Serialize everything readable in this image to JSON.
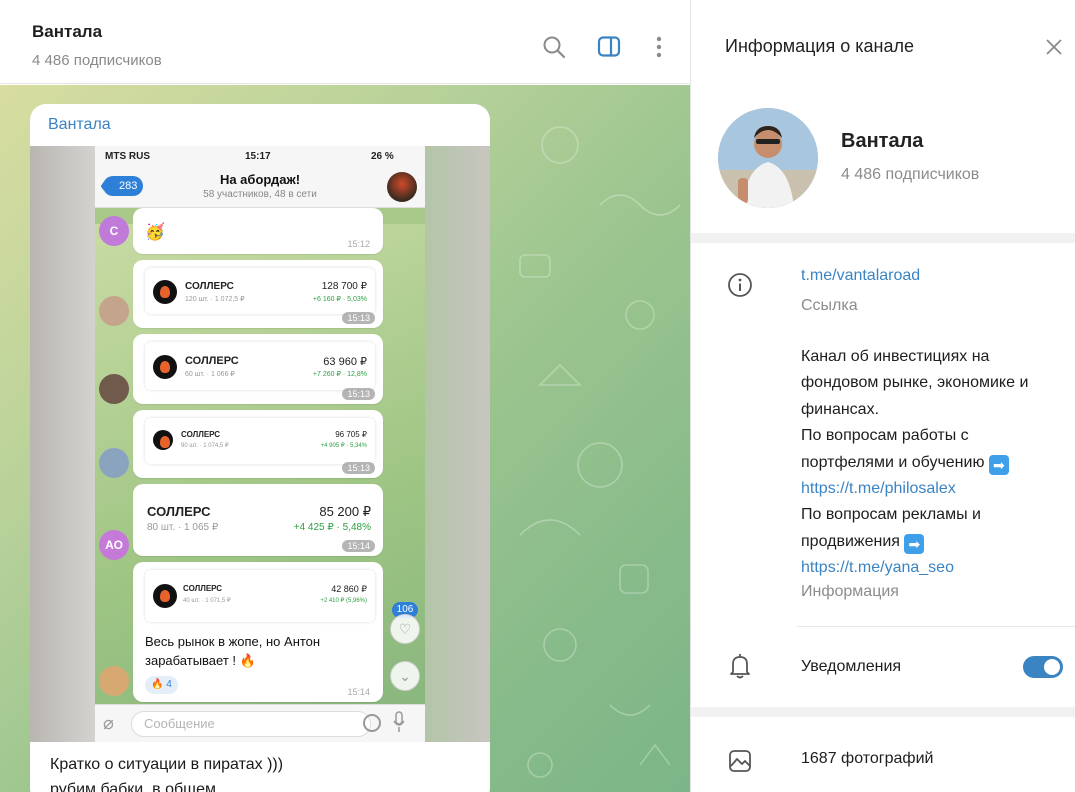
{
  "chat": {
    "title": "Вантала",
    "subscribers": "4 486 подписчиков",
    "message": {
      "author": "Вантала",
      "caption_lines": [
        "Кратко о ситуации в пиратах )))",
        "рубим бабки, в общем."
      ]
    },
    "phone": {
      "carrier": "MTS RUS",
      "time": "15:17",
      "battery": "26 %",
      "back_count": "283",
      "group_title": "На абордаж!",
      "group_sub": "58 участников, 48 в сети",
      "messages": [
        {
          "avatar_letter": "С",
          "time": "15:12"
        },
        {
          "name": "СОЛЛЕРС",
          "sub": "120 шт. · 1 072,5 ₽",
          "value": "128 700 ₽",
          "change": "+6 160 ₽ · 5,03%",
          "time": "15:13"
        },
        {
          "name": "СОЛЛЕРС",
          "sub": "60 шт. · 1 066 ₽",
          "value": "63 960 ₽",
          "change": "+7 260 ₽ · 12,8%",
          "time": "15:13"
        },
        {
          "name": "СОЛЛЕРС",
          "sub": "90 шт. · 1 074,5 ₽",
          "value": "96 705 ₽",
          "change": "+4 905 ₽ · 5,34%",
          "time": "15:13"
        },
        {
          "avatar_letter": "АО",
          "name": "СОЛЛЕРС",
          "sub": "80 шт. · 1 065 ₽",
          "value": "85 200 ₽",
          "change": "+4 425 ₽ · 5,48%",
          "time": "15:14"
        },
        {
          "name": "СОЛЛЕРС",
          "sub": "40 шт. · 1 071,5 ₽",
          "value": "42 860 ₽",
          "change": "+2 410 ₽ (5,96%)",
          "text": "Весь рынок в жопе, но Антон зарабатывает ! 🔥",
          "reaction_count": "4",
          "time": "15:14"
        }
      ],
      "unread_badge": "106",
      "input_placeholder": "Сообщение"
    }
  },
  "info": {
    "title": "Информация о канале",
    "channel_name": "Вантала",
    "channel_subs": "4 486 подписчиков",
    "link": "t.me/vantalaroad",
    "link_label": "Ссылка",
    "description": {
      "line1": "Канал об инвестициях на фондовом рынке, экономике и финансах.",
      "line2": "По вопросам работы с портфелями и обучению",
      "link1": "https://t.me/philosalex",
      "line3": "По вопросам рекламы и продвижения",
      "link2": "https://t.me/yana_seo"
    },
    "description_label": "Информация",
    "notifications_label": "Уведомления",
    "notifications_on": true,
    "photos_label": "1687 фотографий"
  },
  "colors": {
    "accent": "#3a84c3",
    "toggle_on": "#3a84c3",
    "chat_bg_start": "#d8dda0",
    "chat_bg_end": "#7cb588"
  }
}
